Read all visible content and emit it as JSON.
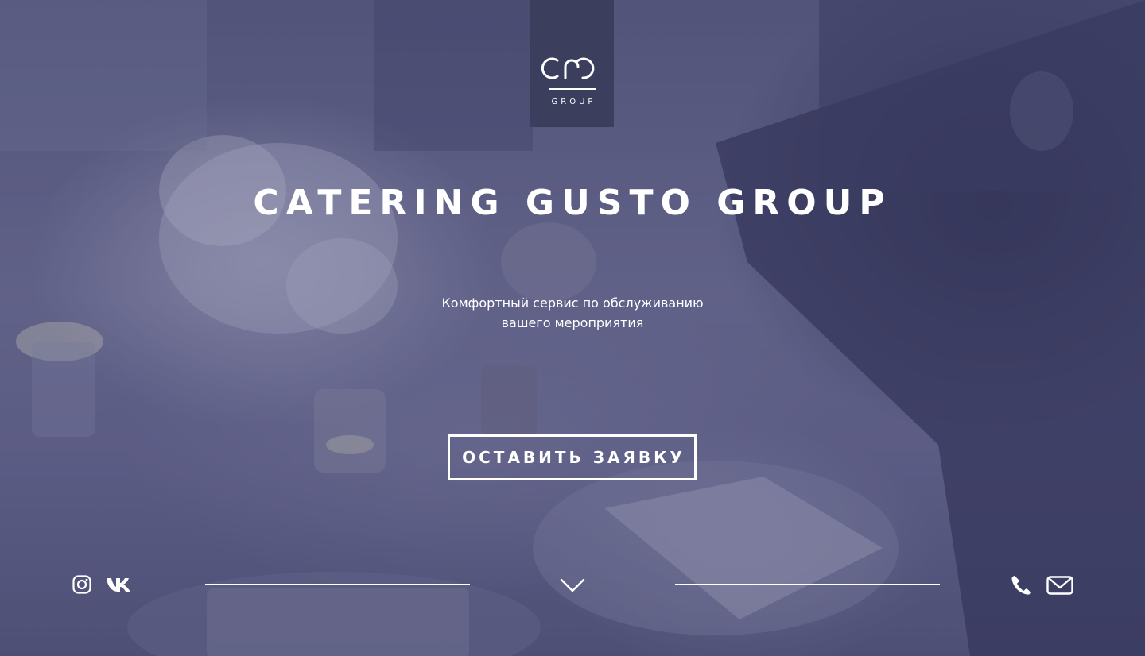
{
  "brand": {
    "logo_text": "GROUP"
  },
  "hero": {
    "title": "CATERING GUSTO GROUP",
    "subtitle_line1": "Комфортный сервис по обслуживанию",
    "subtitle_line2": "вашего мероприятия",
    "cta_label": "ОСТАВИТЬ ЗАЯВКУ"
  },
  "footer": {
    "icons": [
      "instagram-icon",
      "vk-icon",
      "chevron-down-icon",
      "phone-icon",
      "mail-icon"
    ]
  },
  "colors": {
    "overlay": "#5b5d82",
    "logo_box": "#3b3e5c",
    "text": "#ffffff"
  }
}
